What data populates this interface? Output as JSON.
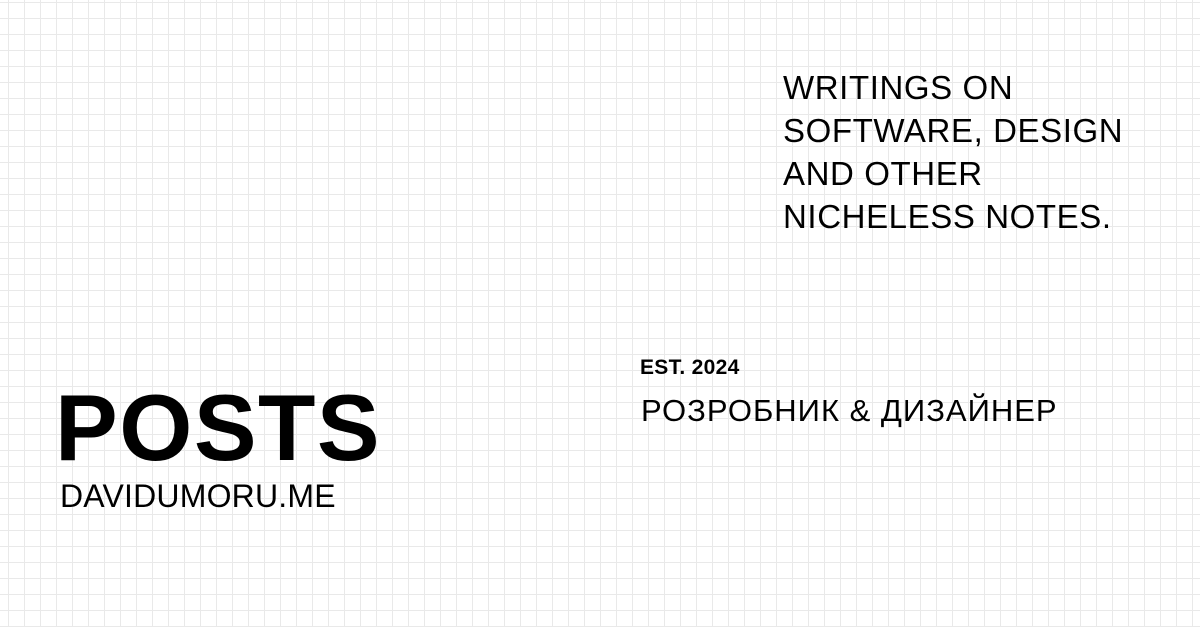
{
  "card": {
    "tagline": "WRITINGS ON\nSOFTWARE, DESIGN\nAND OTHER\nNICHELESS NOTES.",
    "established": "EST. 2024",
    "role": "РОЗРОБНИК & ДИЗАЙНЕР",
    "title": "POSTS",
    "site": "DAVIDUMORU.ME"
  },
  "colors": {
    "background": "#ffffff",
    "grid_line": "#e9e9e9",
    "text": "#000000"
  }
}
